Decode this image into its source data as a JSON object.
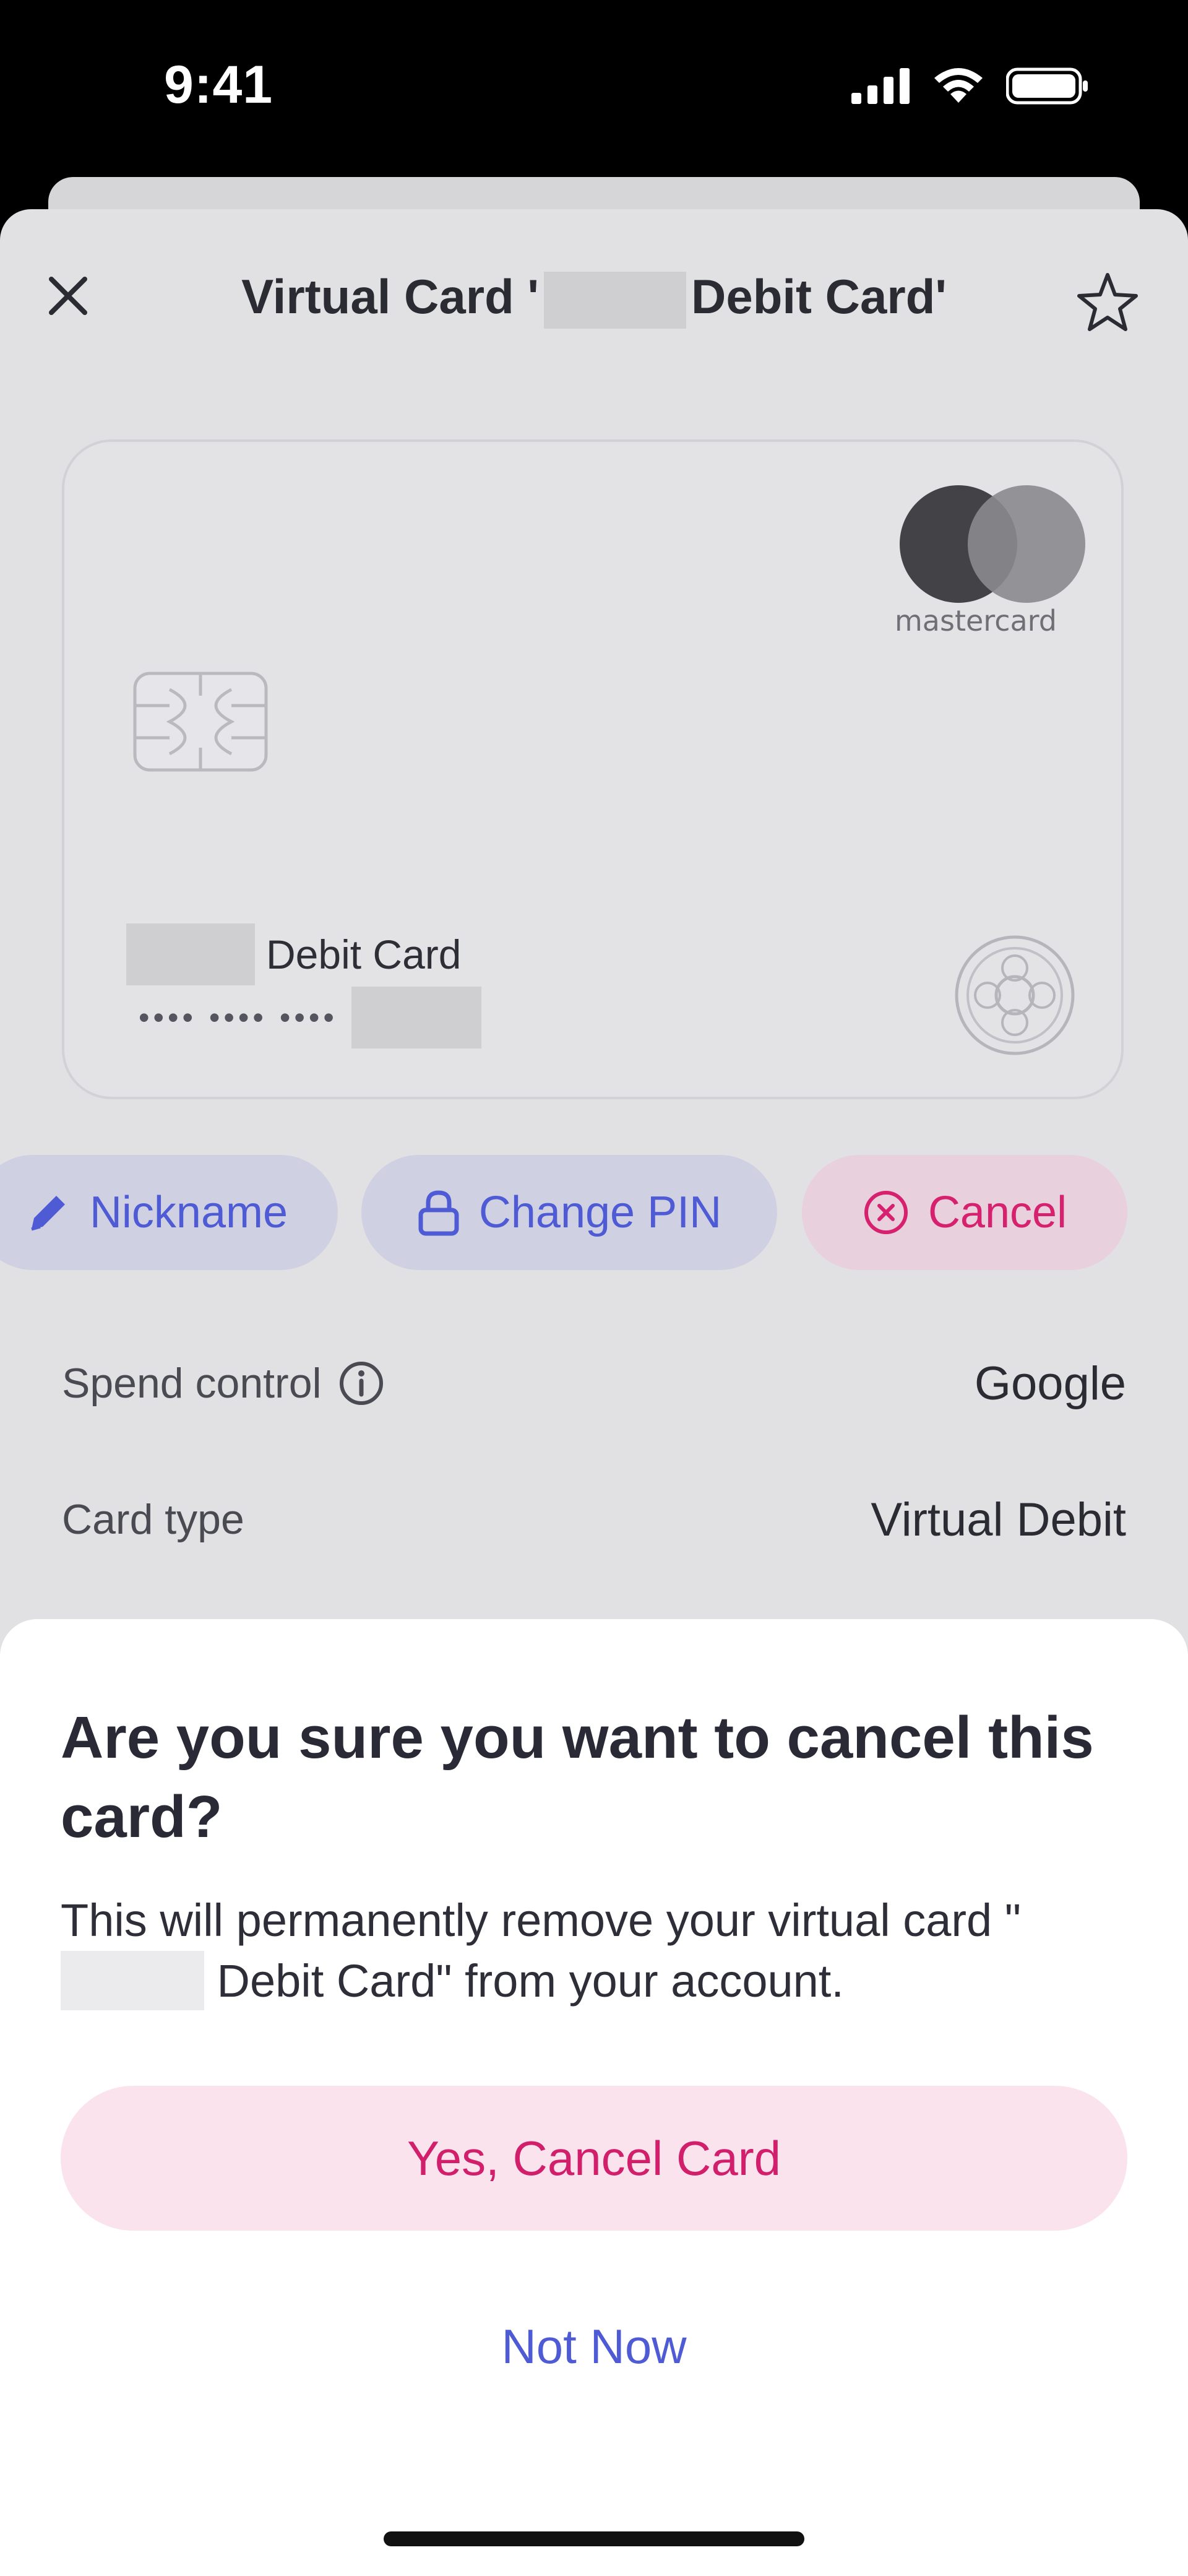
{
  "status_bar": {
    "time": "9:41",
    "icons": [
      "signal-icon",
      "wifi-icon",
      "battery-icon"
    ]
  },
  "header": {
    "title_prefix": "Virtual Card '",
    "title_suffix": "Debit Card'",
    "icons": [
      "close-icon",
      "star-icon"
    ]
  },
  "card": {
    "network": "mastercard",
    "name_suffix": "Debit Card",
    "masked_number": "•••• •••• ••••",
    "icons": [
      "chip-icon",
      "brand-seal-icon"
    ]
  },
  "actions": {
    "nickname_label": "Nickname",
    "change_pin_label": "Change PIN",
    "cancel_label": "Cancel",
    "icons": [
      "pencil-icon",
      "lock-icon",
      "cancel-circle-icon"
    ]
  },
  "details": {
    "spend_control_label": "Spend control",
    "spend_control_value": "Google",
    "card_type_label": "Card type",
    "card_type_value": "Virtual Debit"
  },
  "dialog": {
    "title": "Are you sure you want to cancel this card?",
    "body_prefix": "This will permanently remove your virtual card \"",
    "body_suffix": " Debit Card\" from your account.",
    "confirm_label": "Yes, Cancel Card",
    "dismiss_label": "Not Now"
  },
  "colors": {
    "accent_blue": "#4f5bd5",
    "accent_pink": "#d11f6b",
    "confirm_bg": "#fbe3ee"
  }
}
